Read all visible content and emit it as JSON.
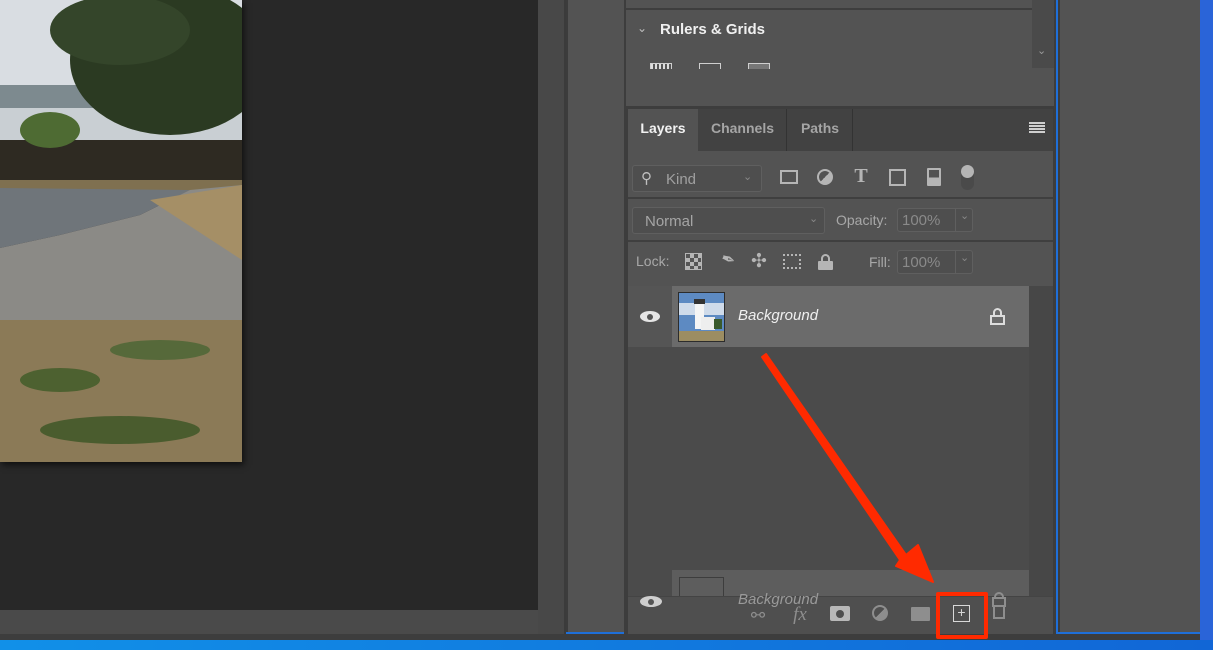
{
  "app": "Photoshop",
  "rulers_panel": {
    "title": "Rulers & Grids",
    "collapse_icon": "chevron-down-icon",
    "scroll_icon": "chevron-down-icon"
  },
  "layers_panel": {
    "tabs": [
      {
        "label": "Layers",
        "active": true
      },
      {
        "label": "Channels",
        "active": false
      },
      {
        "label": "Paths",
        "active": false
      }
    ],
    "menu_icon": "hamburger-menu-icon",
    "filter": {
      "search_icon": "search-icon",
      "kind_label": "Kind",
      "filter_icons": [
        "image-filter-icon",
        "adjustment-filter-icon",
        "type-filter-icon",
        "shape-filter-icon",
        "smart-object-filter-icon",
        "filter-toggle-icon"
      ]
    },
    "blend_mode": "Normal",
    "opacity_label": "Opacity:",
    "opacity_value": "100%",
    "lock_label": "Lock:",
    "lock_icons": [
      "lock-transparent-pixels-icon",
      "lock-image-pixels-icon",
      "lock-position-icon",
      "lock-artboard-icon",
      "lock-all-icon"
    ],
    "fill_label": "Fill:",
    "fill_value": "100%",
    "layers": [
      {
        "name": "Background",
        "visible": true,
        "locked": true
      }
    ],
    "drag_ghost": {
      "name": "Background"
    },
    "bottom_icons": [
      "link-layers-icon",
      "fx-icon",
      "layer-mask-icon",
      "adjustment-layer-icon",
      "new-group-icon",
      "new-layer-icon",
      "delete-layer-icon"
    ],
    "fx_label": "fx"
  },
  "annotation": {
    "color": "#ff2a00",
    "target": "new-layer-button"
  }
}
